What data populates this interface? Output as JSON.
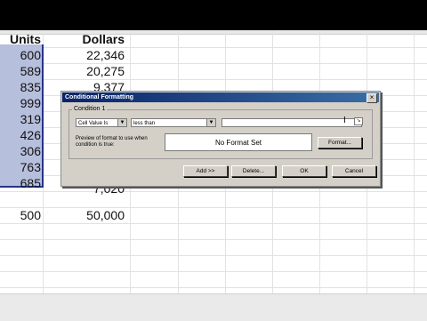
{
  "spreadsheet": {
    "headers": {
      "units": "Units",
      "dollars": "Dollars"
    },
    "rows": [
      {
        "units": "600",
        "dollars": "22,346"
      },
      {
        "units": "589",
        "dollars": "20,275"
      },
      {
        "units": "835",
        "dollars": "9,377"
      },
      {
        "units": "999",
        "dollars": ""
      },
      {
        "units": "319",
        "dollars": ""
      },
      {
        "units": "426",
        "dollars": ""
      },
      {
        "units": "306",
        "dollars": ""
      },
      {
        "units": "763",
        "dollars": ""
      },
      {
        "units": "685",
        "dollars": "7,020"
      }
    ],
    "totals": {
      "units": "500",
      "dollars": "50,000"
    }
  },
  "dialog": {
    "title": "Conditional Formatting",
    "close_label": "×",
    "condition_label": "Condition 1",
    "combo1_value": "Cell Value Is",
    "combo2_value": "less than",
    "value_input": "",
    "preview_label": "Preview of format to use when condition is true:",
    "preview_text": "No Format Set",
    "format_button": "Format...",
    "add_button": "Add >>",
    "delete_button": "Delete...",
    "ok_button": "OK",
    "cancel_button": "Cancel"
  },
  "icons": {
    "dropdown": "chevron-down-icon",
    "cell_picker": "range-picker-icon",
    "text_cursor": "text-cursor-icon"
  },
  "colors": {
    "selection": "#b6bfdc",
    "title_bar": "#0a246a",
    "dialog_face": "#d4d0c8"
  }
}
